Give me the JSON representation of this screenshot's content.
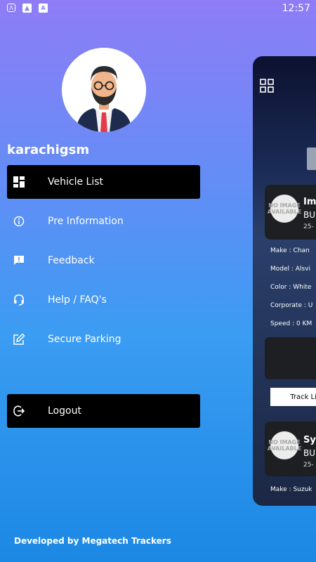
{
  "status_bar": {
    "time": "12:57",
    "icons": [
      "app-a-icon",
      "image-icon",
      "text-a-icon"
    ]
  },
  "profile": {
    "username": "karachigsm",
    "avatar": "man-with-beard-avatar"
  },
  "menu": {
    "items": [
      {
        "label": "Vehicle List",
        "icon": "dashboard-icon",
        "active": true
      },
      {
        "label": "Pre Information",
        "icon": "info-icon",
        "active": false
      },
      {
        "label": "Feedback",
        "icon": "feedback-icon",
        "active": false
      },
      {
        "label": "Help / FAQ's",
        "icon": "headset-icon",
        "active": false
      },
      {
        "label": "Secure Parking",
        "icon": "edit-icon",
        "active": false
      }
    ],
    "logout_label": "Logout"
  },
  "footer": {
    "text": "Developed by Megatech Trackers"
  },
  "preview": {
    "cards": [
      {
        "title": "Im",
        "subtitle": "BU",
        "date": "25-",
        "noimage": "NO IMAGE AVAILABLE"
      },
      {
        "title": "Sy",
        "subtitle": "BU",
        "date": "25-",
        "noimage": "NO IMAGE AVAILABLE"
      }
    ],
    "details": [
      "Make : Chan",
      "Model : Alsvi",
      "Color : White",
      "Corporate : U",
      "Speed : 0 KM"
    ],
    "track_label": "Track Liv",
    "bottom_row": "Make : Suzuk"
  },
  "colors": {
    "gradient_top": "#8f7cf6",
    "gradient_bottom": "#1b88e4",
    "active_item": "#000000"
  }
}
